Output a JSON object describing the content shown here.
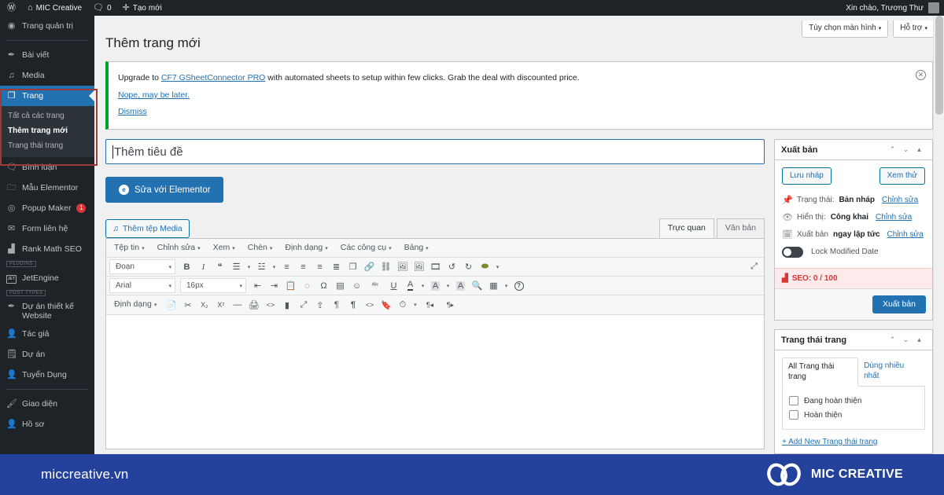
{
  "adminbar": {
    "logo_icon": "wordpress-icon",
    "site_icon": "home-icon",
    "site_name": "MIC Creative",
    "comments_icon": "comment-icon",
    "comments_count": "0",
    "new_icon": "plus-icon",
    "new_label": "Tạo mới",
    "greeting": "Xin chào, Trương Thư"
  },
  "sidebar": {
    "items": [
      {
        "icon": "dashboard-icon",
        "label": "Trang quản trị",
        "glyph": "◉"
      },
      {
        "icon": "pin-icon",
        "label": "Bài viết",
        "glyph": "✒"
      },
      {
        "icon": "media-icon",
        "label": "Media",
        "glyph": "♫"
      },
      {
        "icon": "page-icon",
        "label": "Trang",
        "glyph": "❐",
        "current": true
      },
      {
        "icon": "comment-icon",
        "label": "Bình luận",
        "glyph": "💬"
      },
      {
        "icon": "folder-icon",
        "label": "Mẫu Elementor",
        "glyph": "🗀"
      },
      {
        "icon": "popup-icon",
        "label": "Popup Maker",
        "glyph": "◎",
        "badge": "1"
      },
      {
        "icon": "mail-icon",
        "label": "Form liên hệ",
        "glyph": "✉"
      },
      {
        "icon": "chart-icon",
        "label": "Rank Math SEO",
        "glyph": "▟"
      }
    ],
    "submenu": [
      {
        "label": "Tất cả các trang",
        "active": false
      },
      {
        "label": "Thêm trang mới",
        "active": true
      },
      {
        "label": "Trang thái trang",
        "active": false
      }
    ],
    "group_plugins_label": "PLUGINS",
    "plugins": [
      {
        "icon": "jetengine-icon",
        "label": "JetEngine"
      }
    ],
    "group_posttypes_label": "POST TYPES",
    "posttypes": [
      {
        "icon": "pin-icon",
        "label": "Dự án thiết kế Website",
        "glyph": "✒"
      },
      {
        "icon": "user-icon",
        "label": "Tác giả",
        "glyph": "👤"
      },
      {
        "icon": "clipboard-icon",
        "label": "Dự án",
        "glyph": "🗒"
      },
      {
        "icon": "user-icon",
        "label": "Tuyển Dụng",
        "glyph": "👤"
      }
    ],
    "bottom": [
      {
        "icon": "brush-icon",
        "label": "Giao diện",
        "glyph": "🖌"
      },
      {
        "icon": "user-icon",
        "label": "Hồ sơ",
        "glyph": "👤"
      }
    ]
  },
  "screen_meta": {
    "screen_options": "Tùy chọn màn hình",
    "help": "Hỗ trợ",
    "caret": "▾"
  },
  "page": {
    "title": "Thêm trang mới"
  },
  "notice": {
    "text_before": "Upgrade to ",
    "link": "CF7 GSheetConnector PRO",
    "text_after": " with automated sheets to setup within few clicks. Grab the deal with discounted price.",
    "link_later": "Nope, may be later.",
    "link_dismiss": "Dismiss",
    "close_icon": "close-icon",
    "close_glyph": "✕"
  },
  "title_input": {
    "placeholder": "Thêm tiêu đề",
    "value": ""
  },
  "elementor": {
    "label": "Sửa với Elementor",
    "icon_letter": "e"
  },
  "editor": {
    "media_button": "Thêm tệp Media",
    "media_icon": "media-icon",
    "tabs": [
      {
        "label": "Trực quan",
        "active": true
      },
      {
        "label": "Văn bản",
        "active": false
      }
    ],
    "menubar": [
      "Tệp tin",
      "Chỉnh sửa",
      "Xem",
      "Chèn",
      "Định dạng",
      "Các công cụ",
      "Bảng"
    ],
    "row_format": {
      "block_select": "Đoạn",
      "buttons": [
        {
          "name": "bold-icon",
          "glyph": "B"
        },
        {
          "name": "italic-icon",
          "glyph": "I"
        },
        {
          "name": "blockquote-icon",
          "glyph": "❝"
        },
        {
          "name": "bullet-list-icon",
          "glyph": "☰"
        },
        {
          "name": "bullet-list-caret-icon",
          "glyph": "▾"
        },
        {
          "name": "numbered-list-icon",
          "glyph": "☳"
        },
        {
          "name": "numbered-list-caret-icon",
          "glyph": "▾"
        },
        {
          "name": "align-left-icon",
          "glyph": "≡"
        },
        {
          "name": "align-center-icon",
          "glyph": "≡"
        },
        {
          "name": "align-right-icon",
          "glyph": "≡"
        },
        {
          "name": "align-justify-icon",
          "glyph": "≣"
        },
        {
          "name": "copy-icon",
          "glyph": "❐"
        },
        {
          "name": "link-icon",
          "glyph": "🔗"
        },
        {
          "name": "unlink-icon",
          "glyph": "⛓"
        },
        {
          "name": "image-icon",
          "glyph": "🖼"
        },
        {
          "name": "gallery-icon",
          "glyph": "🖼"
        },
        {
          "name": "video-icon",
          "glyph": "🎞"
        },
        {
          "name": "undo-icon",
          "glyph": "↺"
        },
        {
          "name": "redo-icon",
          "glyph": "↻"
        },
        {
          "name": "olive-icon",
          "glyph": "⬬"
        },
        {
          "name": "olive-caret-icon",
          "glyph": "▾"
        }
      ],
      "fullscreen_icon": "fullscreen-icon",
      "fullscreen_glyph": "⤢"
    },
    "row_font": {
      "font_family": "Arial",
      "font_size": "16px",
      "buttons": [
        {
          "name": "indent-decrease-icon",
          "glyph": "⇤"
        },
        {
          "name": "indent-increase-icon",
          "glyph": "⇥"
        },
        {
          "name": "paste-icon",
          "glyph": "📋"
        },
        {
          "name": "eraser-icon",
          "glyph": "◌"
        },
        {
          "name": "special-character-icon",
          "glyph": "Ω"
        },
        {
          "name": "horizontal-line-icon",
          "glyph": "▤"
        },
        {
          "name": "emoticon-icon",
          "glyph": "☺"
        },
        {
          "name": "spellcheck-icon",
          "glyph": "ᴬᴮᶜ"
        },
        {
          "name": "underline-icon",
          "glyph": "U"
        },
        {
          "name": "text-color-icon",
          "glyph": "A"
        },
        {
          "name": "text-color-caret-icon",
          "glyph": "▾"
        },
        {
          "name": "background-color-icon",
          "glyph": "A"
        },
        {
          "name": "background-color-caret-icon",
          "glyph": "▾"
        },
        {
          "name": "highlight-icon",
          "glyph": "A"
        },
        {
          "name": "find-replace-icon",
          "glyph": "🔍"
        },
        {
          "name": "table-icon",
          "glyph": "▦"
        },
        {
          "name": "table-caret-icon",
          "glyph": "▾"
        },
        {
          "name": "help-icon",
          "glyph": "?"
        }
      ]
    },
    "row_tools": {
      "format_menu": "Định dạng",
      "buttons": [
        {
          "name": "paste-text-icon",
          "glyph": "📄"
        },
        {
          "name": "cut-icon",
          "glyph": "✂"
        },
        {
          "name": "subscript-icon",
          "glyph": "X₂"
        },
        {
          "name": "superscript-icon",
          "glyph": "X²"
        },
        {
          "name": "horizontal-rule-icon",
          "glyph": "—"
        },
        {
          "name": "print-icon",
          "glyph": "🖨"
        },
        {
          "name": "source-code-icon",
          "glyph": "<>"
        },
        {
          "name": "page-break-icon",
          "glyph": "▮"
        },
        {
          "name": "fullscreen-icon",
          "glyph": "⤢"
        },
        {
          "name": "import-icon",
          "glyph": "⇪"
        },
        {
          "name": "paragraph-icon",
          "glyph": "¶"
        },
        {
          "name": "paragraph-mark-icon",
          "glyph": "¶"
        },
        {
          "name": "code-icon",
          "glyph": "<>"
        },
        {
          "name": "bookmark-icon",
          "glyph": "🔖"
        },
        {
          "name": "clock-icon",
          "glyph": "⏱"
        },
        {
          "name": "clock-caret-icon",
          "glyph": "▾"
        },
        {
          "name": "ltr-icon",
          "glyph": "¶◂"
        },
        {
          "name": "rtl-icon",
          "glyph": "¶▸"
        }
      ]
    }
  },
  "publish_panel": {
    "title": "Xuất bản",
    "head_icons": [
      {
        "name": "move-up-icon",
        "glyph": "⌃"
      },
      {
        "name": "move-down-icon",
        "glyph": "⌄"
      },
      {
        "name": "toggle-panel-icon",
        "glyph": "▴"
      }
    ],
    "save_draft": "Lưu nháp",
    "preview": "Xem thử",
    "status_icon": "pin-icon",
    "status_label": "Trạng thái:",
    "status_value": "Bản nháp",
    "status_edit": "Chỉnh sửa",
    "visibility_icon": "eye-icon",
    "visibility_label": "Hiển thị:",
    "visibility_value": "Công khai",
    "visibility_edit": "Chỉnh sửa",
    "schedule_icon": "calendar-icon",
    "schedule_label": "Xuất bản",
    "schedule_value": "ngay lập tức",
    "schedule_edit": "Chỉnh sửa",
    "lock_toggle_label": "Lock Modified Date",
    "seo_icon": "rank-math-icon",
    "seo_text": "SEO: 0 / 100",
    "publish_button": "Xuất bản"
  },
  "taxonomy_panel": {
    "title": "Trang thái trang",
    "head_icons": [
      {
        "name": "move-up-icon",
        "glyph": "⌃"
      },
      {
        "name": "move-down-icon",
        "glyph": "⌄"
      },
      {
        "name": "toggle-panel-icon",
        "glyph": "▴"
      }
    ],
    "tabs": [
      {
        "label": "All Trang thái trang",
        "active": true
      },
      {
        "label": "Dùng nhiều nhất",
        "active": false
      }
    ],
    "terms": [
      {
        "label": "Đang hoàn thiện",
        "checked": false
      },
      {
        "label": "Hoàn thiện",
        "checked": false
      }
    ],
    "add_new": "+ Add New Trang thái trang"
  },
  "banner": {
    "site": "miccreative.vn",
    "brand": "MIC CREATIVE",
    "logo_icon": "infinity-logo-icon",
    "bg_color": "#24429b"
  },
  "colors": {
    "admin_dark": "#1d2327",
    "admin_current": "#2271b1",
    "accent_blue": "#2271b1",
    "notice_green": "#00a32a",
    "seo_red": "#d63638",
    "highlight_red": "#9e3b38"
  }
}
